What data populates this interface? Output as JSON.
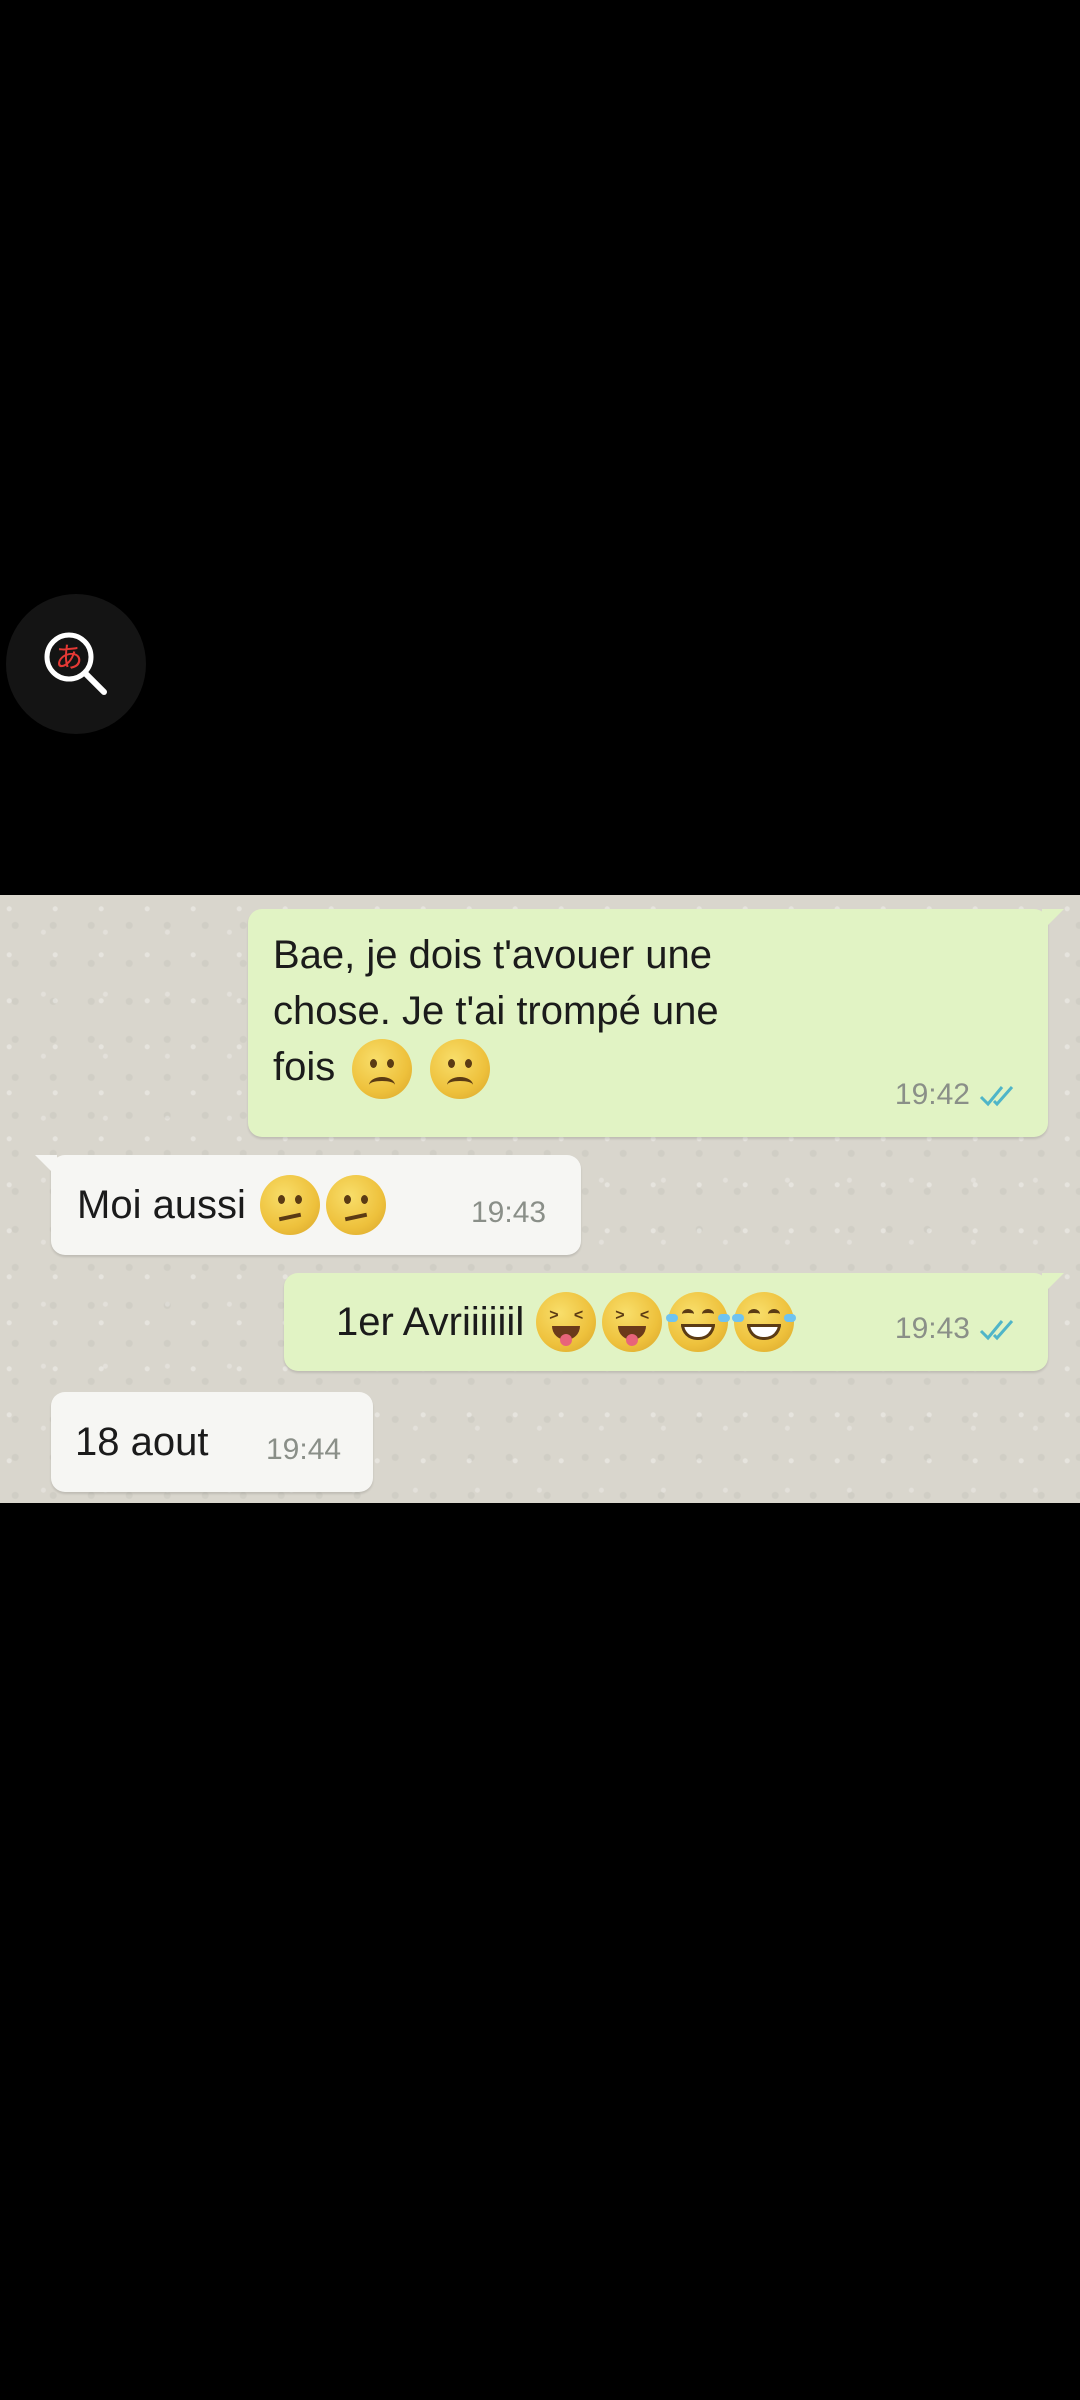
{
  "overlay": {
    "lens_icon": "translate-search-icon"
  },
  "chat": {
    "messages": [
      {
        "direction": "outgoing",
        "lines": [
          "Bae, je dois t'avouer une",
          "chose. Je t'ai trompé une",
          "fois"
        ],
        "emoji": [
          "slightly-frowning-face",
          "slightly-frowning-face"
        ],
        "time": "19:42",
        "status": "double-check"
      },
      {
        "direction": "incoming",
        "text": "Moi aussi",
        "emoji": [
          "confused-face",
          "confused-face"
        ],
        "time": "19:43"
      },
      {
        "direction": "outgoing",
        "text": "1er Avriiiiiil",
        "emoji": [
          "squinting-face-with-tongue",
          "squinting-face-with-tongue",
          "face-with-tears-of-joy",
          "face-with-tears-of-joy"
        ],
        "time": "19:43",
        "status": "double-check"
      },
      {
        "direction": "incoming",
        "text": "18 aout",
        "time": "19:44"
      }
    ]
  },
  "colors": {
    "outgoing_bubble": "#e1f3c4",
    "incoming_bubble": "#f6f6f3",
    "chat_background": "#d9d6cd",
    "tick_color": "#4fb5c8",
    "page_background": "#000000"
  }
}
